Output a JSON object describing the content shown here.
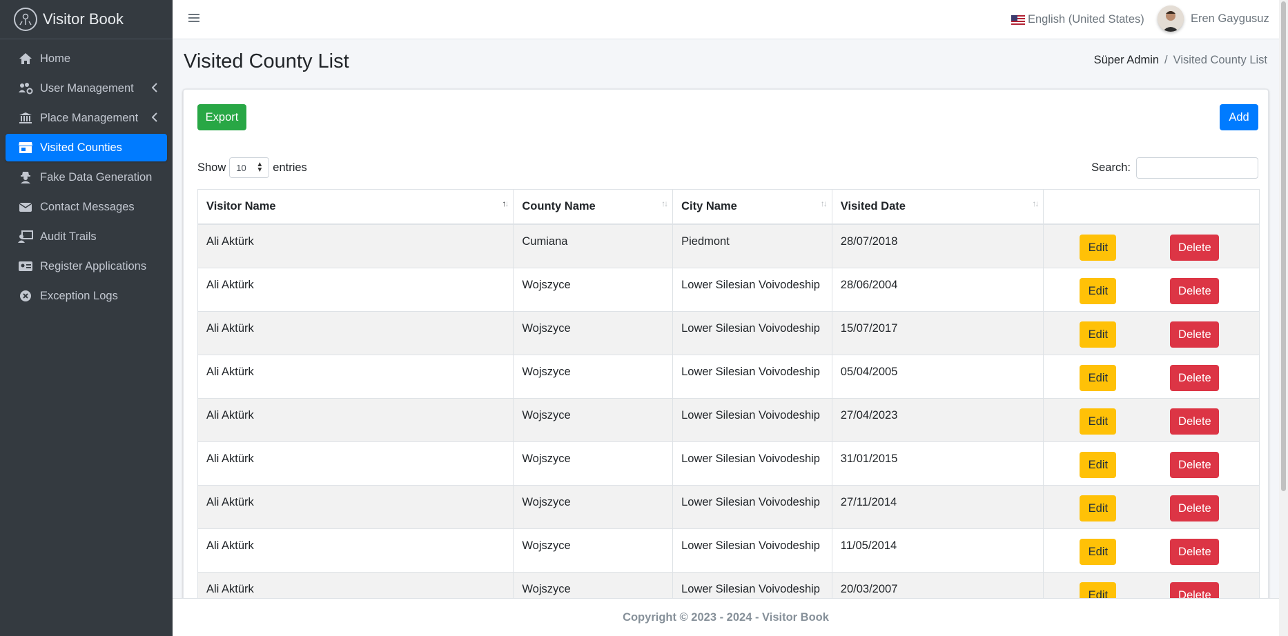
{
  "brand": {
    "name": "Visitor Book"
  },
  "sidebar": {
    "items": [
      {
        "label": "Home",
        "icon": "home-icon"
      },
      {
        "label": "User Management",
        "icon": "users-cog-icon",
        "has_children": true
      },
      {
        "label": "Place Management",
        "icon": "landmark-icon",
        "has_children": true
      },
      {
        "label": "Visited Counties",
        "icon": "store-icon",
        "active": true
      },
      {
        "label": "Fake Data Generation",
        "icon": "user-secret-icon"
      },
      {
        "label": "Contact Messages",
        "icon": "envelope-icon"
      },
      {
        "label": "Audit Trails",
        "icon": "chalkboard-teacher-icon"
      },
      {
        "label": "Register Applications",
        "icon": "id-card-icon"
      },
      {
        "label": "Exception Logs",
        "icon": "times-circle-icon"
      }
    ]
  },
  "topbar": {
    "language": "English (United States)",
    "user_name": "Eren Gaygusuz"
  },
  "page": {
    "title": "Visited County List",
    "breadcrumb": {
      "parent": "Süper Admin",
      "separator": "/",
      "current": "Visited County List"
    }
  },
  "toolbar": {
    "export_label": "Export",
    "add_label": "Add"
  },
  "table_controls": {
    "show_label": "Show",
    "entries_value": "10",
    "entries_label": "entries",
    "search_label": "Search:"
  },
  "table": {
    "headers": [
      "Visitor Name",
      "County Name",
      "City Name",
      "Visited Date",
      ""
    ],
    "edit_label": "Edit",
    "delete_label": "Delete",
    "rows": [
      [
        "Ali Aktürk",
        "Cumiana",
        "Piedmont",
        "28/07/2018"
      ],
      [
        "Ali Aktürk",
        "Wojszyce",
        "Lower Silesian Voivodeship",
        "28/06/2004"
      ],
      [
        "Ali Aktürk",
        "Wojszyce",
        "Lower Silesian Voivodeship",
        "15/07/2017"
      ],
      [
        "Ali Aktürk",
        "Wojszyce",
        "Lower Silesian Voivodeship",
        "05/04/2005"
      ],
      [
        "Ali Aktürk",
        "Wojszyce",
        "Lower Silesian Voivodeship",
        "27/04/2023"
      ],
      [
        "Ali Aktürk",
        "Wojszyce",
        "Lower Silesian Voivodeship",
        "31/01/2015"
      ],
      [
        "Ali Aktürk",
        "Wojszyce",
        "Lower Silesian Voivodeship",
        "27/11/2014"
      ],
      [
        "Ali Aktürk",
        "Wojszyce",
        "Lower Silesian Voivodeship",
        "11/05/2014"
      ],
      [
        "Ali Aktürk",
        "Wojszyce",
        "Lower Silesian Voivodeship",
        "20/03/2007"
      ]
    ]
  },
  "footer": {
    "text": "Copyright © 2023 - 2024 - Visitor Book"
  }
}
